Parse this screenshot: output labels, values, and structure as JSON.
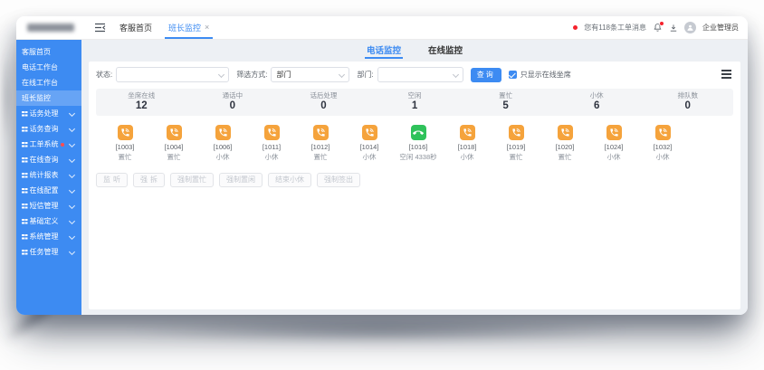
{
  "colors": {
    "accent": "#3d8bf2",
    "busy_orange": "#f5a33c",
    "idle_green": "#2fc25b",
    "danger_red": "#f5222d",
    "sidebar_blue": "#3d8bf2"
  },
  "topbar": {
    "tabs": [
      {
        "label": "客服首页",
        "active": false,
        "closable": false
      },
      {
        "label": "班长监控",
        "active": true,
        "closable": true
      }
    ],
    "close_glyph": "×",
    "right": {
      "message": "您有118条工单消息",
      "username": "企业管理员"
    }
  },
  "sidebar": {
    "items": [
      {
        "label": "客服首页",
        "active": false,
        "expandable": false,
        "badge": false
      },
      {
        "label": "电话工作台",
        "active": false,
        "expandable": false,
        "badge": false
      },
      {
        "label": "在线工作台",
        "active": false,
        "expandable": false,
        "badge": false
      },
      {
        "label": "班长监控",
        "active": true,
        "expandable": false,
        "badge": false
      },
      {
        "label": "话务处理",
        "active": false,
        "expandable": true,
        "badge": false
      },
      {
        "label": "话务查询",
        "active": false,
        "expandable": true,
        "badge": false
      },
      {
        "label": "工单系统",
        "active": false,
        "expandable": true,
        "badge": true
      },
      {
        "label": "在线查询",
        "active": false,
        "expandable": true,
        "badge": false
      },
      {
        "label": "统计报表",
        "active": false,
        "expandable": true,
        "badge": false
      },
      {
        "label": "在线配置",
        "active": false,
        "expandable": true,
        "badge": false
      },
      {
        "label": "短信管理",
        "active": false,
        "expandable": true,
        "badge": false
      },
      {
        "label": "基础定义",
        "active": false,
        "expandable": true,
        "badge": false
      },
      {
        "label": "系统管理",
        "active": false,
        "expandable": true,
        "badge": false
      },
      {
        "label": "任务管理",
        "active": false,
        "expandable": true,
        "badge": false
      }
    ]
  },
  "main": {
    "tabs": [
      {
        "label": "电话监控",
        "active": true
      },
      {
        "label": "在线监控",
        "active": false
      }
    ],
    "filters": {
      "status_label": "状态:",
      "status_value": "",
      "method_label": "筛选方式:",
      "method_value": "部门",
      "dept_label": "部门:",
      "dept_value": "",
      "search_label": "查询",
      "checkbox_label": "只显示在线坐席",
      "checkbox_checked": true
    },
    "stats": [
      {
        "label": "坐席在线",
        "value": "12"
      },
      {
        "label": "通话中",
        "value": "0"
      },
      {
        "label": "话后处理",
        "value": "0"
      },
      {
        "label": "空闲",
        "value": "1"
      },
      {
        "label": "置忙",
        "value": "5"
      },
      {
        "label": "小休",
        "value": "6"
      },
      {
        "label": "排队数",
        "value": "0"
      }
    ],
    "agents": [
      {
        "id": "[1003]",
        "status": "置忙",
        "state": "busy"
      },
      {
        "id": "[1004]",
        "status": "置忙",
        "state": "busy"
      },
      {
        "id": "[1006]",
        "status": "小休",
        "state": "busy"
      },
      {
        "id": "[1011]",
        "status": "小休",
        "state": "busy"
      },
      {
        "id": "[1012]",
        "status": "置忙",
        "state": "busy"
      },
      {
        "id": "[1014]",
        "status": "小休",
        "state": "busy"
      },
      {
        "id": "[1016]",
        "status": "空闲 4338秒",
        "state": "idle"
      },
      {
        "id": "[1018]",
        "status": "小休",
        "state": "busy"
      },
      {
        "id": "[1019]",
        "status": "置忙",
        "state": "busy"
      },
      {
        "id": "[1020]",
        "status": "置忙",
        "state": "busy"
      },
      {
        "id": "[1024]",
        "status": "小休",
        "state": "busy"
      },
      {
        "id": "[1032]",
        "status": "小休",
        "state": "busy"
      }
    ],
    "actions": [
      "监听",
      "强拆",
      "强制置忙",
      "强制置闲",
      "结束小休",
      "强制签出"
    ]
  }
}
